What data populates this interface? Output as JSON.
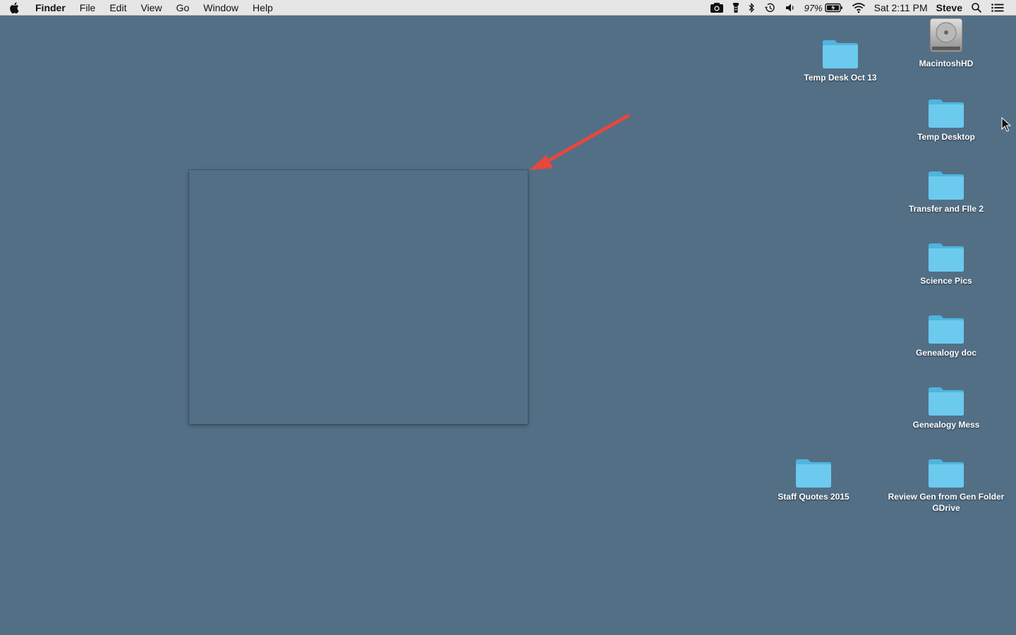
{
  "menubar": {
    "apple_icon": "apple-logo-icon",
    "app_name": "Finder",
    "menus": [
      "File",
      "Edit",
      "View",
      "Go",
      "Window",
      "Help"
    ],
    "status": {
      "battery_pct": "97%",
      "clock": "Sat 2:11 PM",
      "user": "Steve"
    }
  },
  "desktop": {
    "icons": [
      {
        "label": "MacintoshHD",
        "icon": "hard-drive-icon"
      },
      {
        "label": "Temp Desk Oct 13",
        "icon": "folder-icon"
      },
      {
        "label": "Temp Desktop",
        "icon": "folder-icon"
      },
      {
        "label": "Transfer and FIle 2",
        "icon": "folder-icon"
      },
      {
        "label": "Science Pics",
        "icon": "folder-icon"
      },
      {
        "label": "Genealogy doc",
        "icon": "folder-icon"
      },
      {
        "label": "Genealogy Mess",
        "icon": "folder-icon"
      },
      {
        "label": "Staff Quotes 2015",
        "icon": "folder-icon"
      },
      {
        "label": "Review Gen from Gen Folder GDrive",
        "icon": "folder-icon"
      }
    ],
    "colors": {
      "background": "#526f86",
      "folder": "#5fc3e8",
      "arrow": "#e8473b"
    }
  }
}
